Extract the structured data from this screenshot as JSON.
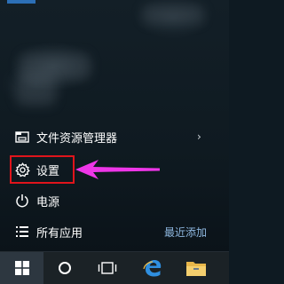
{
  "menu": {
    "items": [
      {
        "label": "文件资源管理器",
        "icon": "file-explorer-icon",
        "has_submenu": true
      },
      {
        "label": "设置",
        "icon": "gear-icon",
        "highlighted": true
      },
      {
        "label": "电源",
        "icon": "power-icon"
      },
      {
        "label": "所有应用",
        "icon": "all-apps-icon"
      }
    ],
    "recently_added": "最近添加"
  },
  "annotation": {
    "box_color": "#e0141b",
    "arrow_color": "#ee36e8"
  },
  "taskbar": {
    "items": [
      "start-windows-icon",
      "cortana-circle-icon",
      "task-view-icon",
      "edge-icon",
      "folder-icon"
    ]
  },
  "colors": {
    "accent_tile": "#2c6fb6",
    "link": "#8fb8e0"
  }
}
